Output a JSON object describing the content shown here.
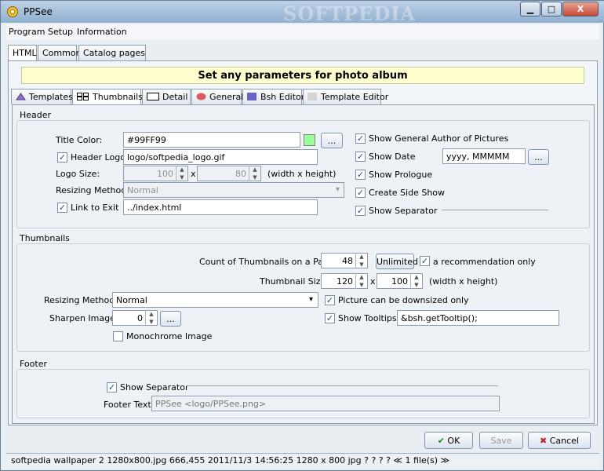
{
  "window": {
    "title": "PPSee",
    "watermark": "SOFTPEDIA",
    "controls": {
      "minimize": "▁",
      "maximize": "□",
      "close": "X"
    }
  },
  "menu": {
    "program": "Program",
    "setup": "Setup",
    "information": "Information"
  },
  "outer_tabs": {
    "html": "HTML",
    "common": "Common",
    "catalog": "Catalog pages"
  },
  "banner": "Set any parameters for photo album",
  "inner_tabs": {
    "templates": "Templates",
    "thumbnails": "Thumbnails",
    "detail": "Detail",
    "general": "General",
    "bsh_editor": "Bsh Editor",
    "template_editor": "Template Editor"
  },
  "header": {
    "section_title": "Header",
    "title_color_label": "Title Color:",
    "title_color_value": "#99FF99",
    "header_logo_label": "Header Logo",
    "header_logo_value": "logo/softpedia_logo.gif",
    "logo_size_label": "Logo Size:",
    "logo_width": "100",
    "logo_x": "x",
    "logo_height": "80",
    "logo_size_hint": "(width x height)",
    "resizing_label": "Resizing Method:",
    "resizing_value": "Normal",
    "link_exit_label": "Link to Exit",
    "link_exit_value": "../index.html",
    "browse": "...",
    "show_author": "Show General Author of Pictures",
    "show_date": "Show Date",
    "date_format": "yyyy, MMMMM",
    "show_prologue": "Show Prologue",
    "create_slide_show": "Create Side Show",
    "show_separator": "Show Separator"
  },
  "thumbnails": {
    "section_title": "Thumbnails",
    "count_label": "Count of Thumbnails on a Page:",
    "count_value": "48",
    "unlimited": "Unlimited",
    "recommendation": "a recommendation only",
    "size_label": "Thumbnail Size:",
    "size_width": "120",
    "size_x": "x",
    "size_height": "100",
    "size_hint": "(width x height)",
    "resizing_label": "Resizing Method:",
    "resizing_value": "Normal",
    "downsized": "Picture can be downsized only",
    "sharpen_label": "Sharpen Image:",
    "sharpen_value": "0",
    "browse": "...",
    "show_tooltips": "Show Tooltips",
    "tooltip_value": "&bsh.getTooltip();",
    "monochrome": "Monochrome Image"
  },
  "footer": {
    "section_title": "Footer",
    "show_separator": "Show Separator",
    "footer_text_label": "Footer Text:",
    "footer_text_value": "PPSee <logo/PPSee.png>"
  },
  "buttons": {
    "ok": "OK",
    "save": "Save",
    "cancel": "Cancel"
  },
  "status": "softpedia  wallpaper  2  1280x800.jpg     666,455   2011/11/3 14:56:25   1280 x 800   jpg   ?  ?  ?  ?  ≪ 1 file(s) ≫",
  "colors": {
    "title_swatch": "#99FF99",
    "banner_bg": "#FFFFD0"
  }
}
